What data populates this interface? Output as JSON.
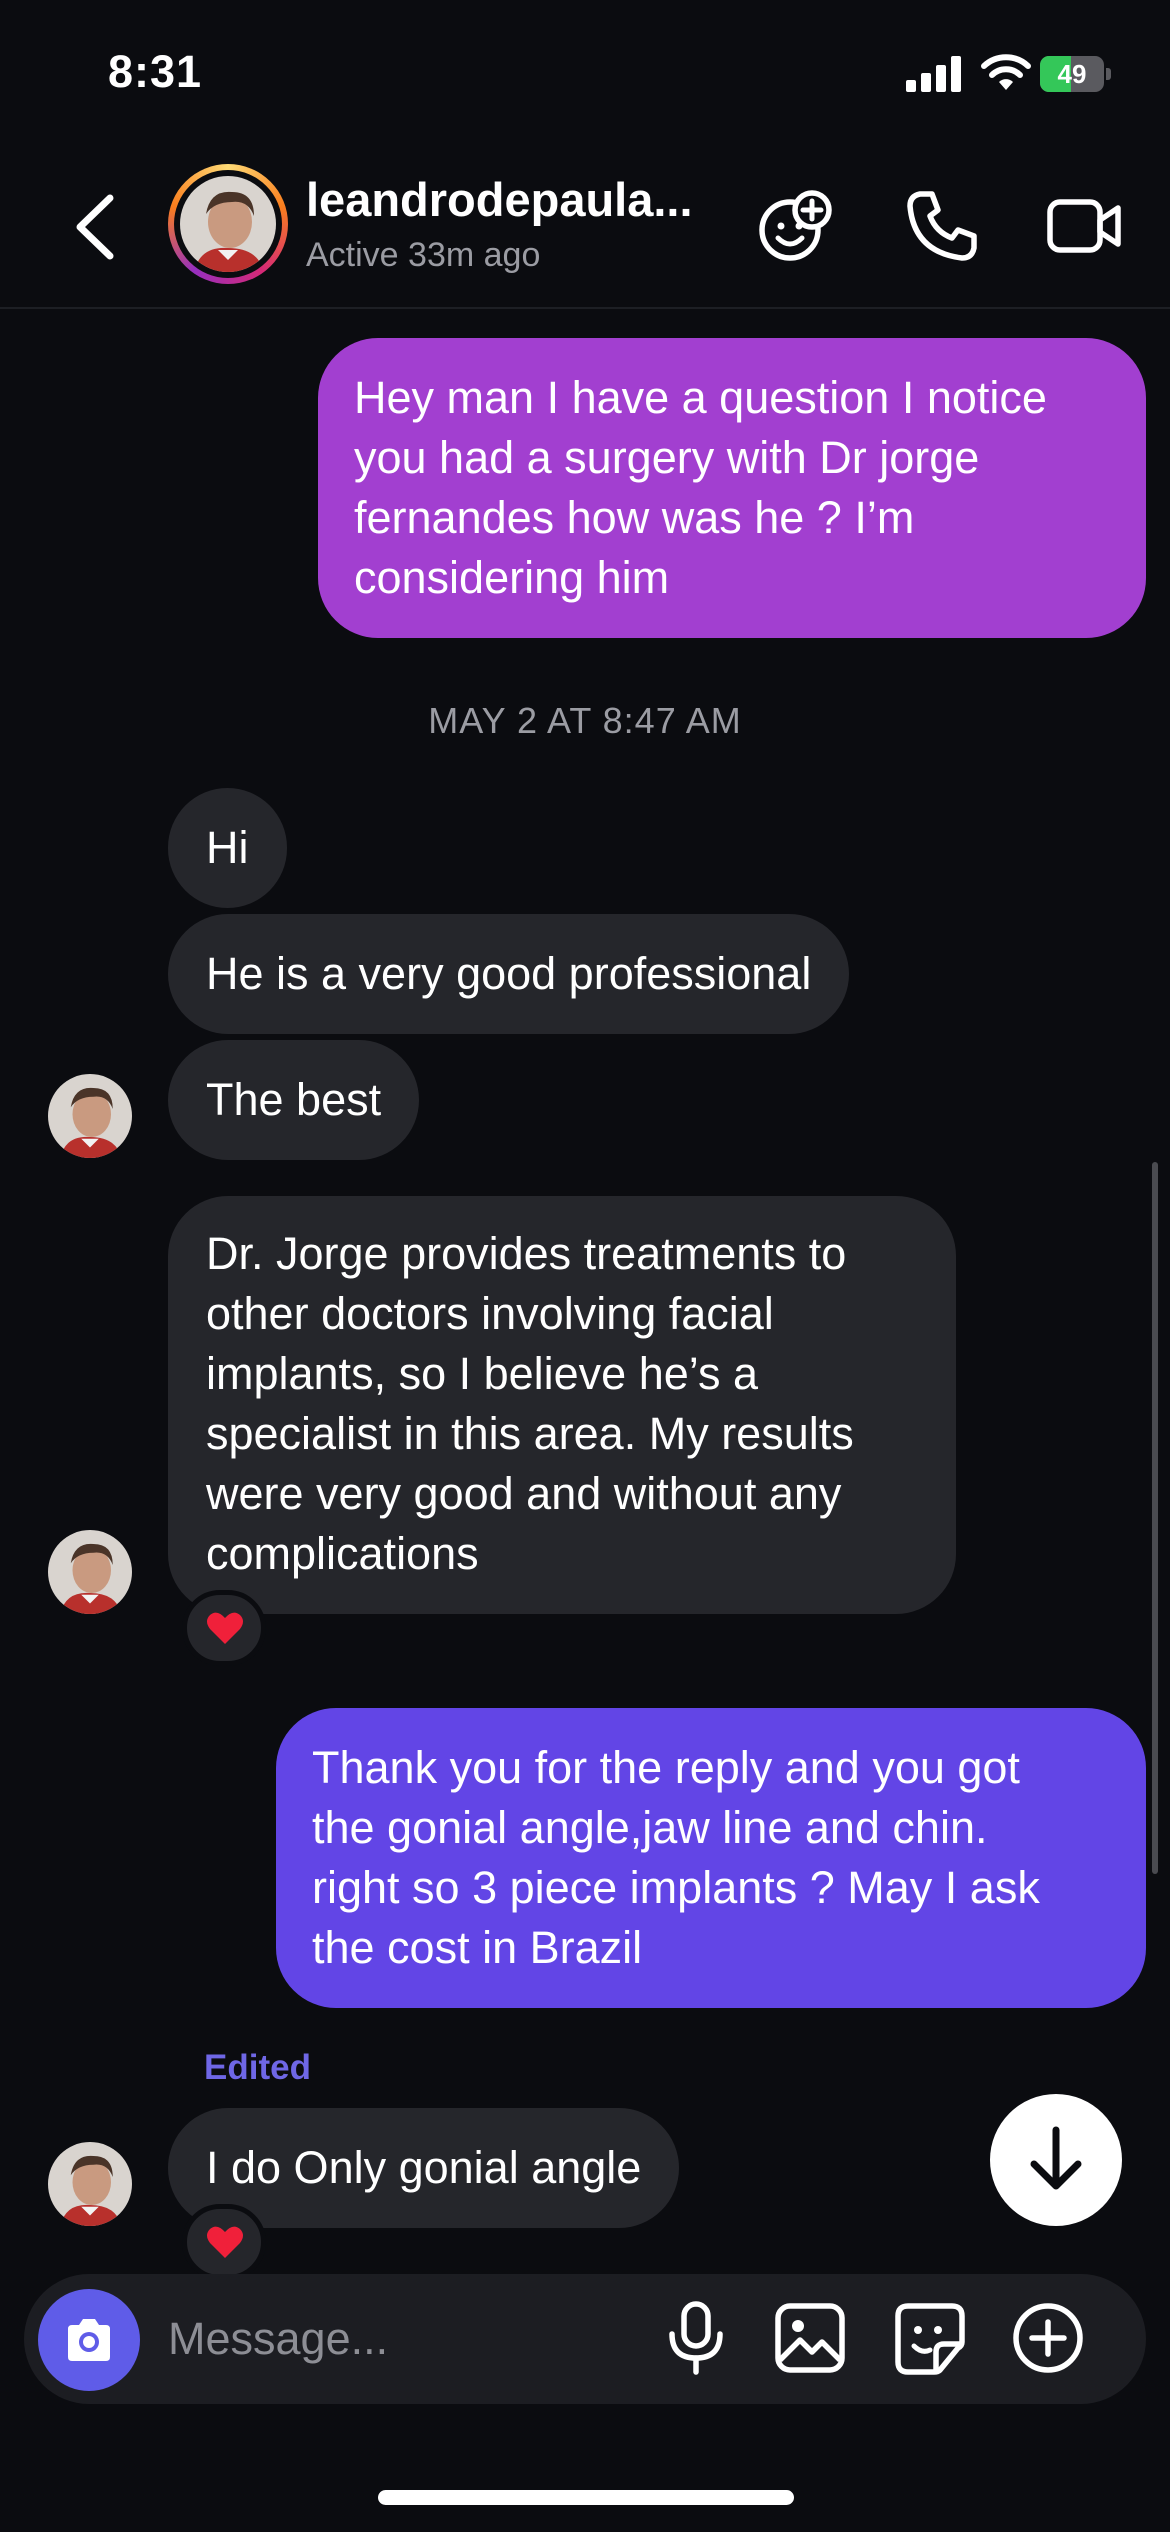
{
  "status_bar": {
    "time": "8:31",
    "battery": "49"
  },
  "header": {
    "username": "leandrodepaula...",
    "status": "Active 33m ago"
  },
  "messages": {
    "m1": [
      "Hey man I have a question I notice",
      "you had a surgery with Dr jorge",
      "fernandes how was he ? I’m",
      "considering him"
    ],
    "date_separator": "MAY 2 AT 8:47 AM",
    "m2": "Hi",
    "m3": "He is a very good professional",
    "m4": "The best",
    "m5": [
      "Dr. Jorge provides treatments to",
      "other doctors involving facial",
      "implants, so I believe he’s a",
      "specialist in this area. My results",
      "were very good and without any",
      "complications"
    ],
    "m6": [
      "Thank you for the reply and you got",
      "the gonial angle,jaw line and chin.",
      "right so 3 piece implants ? May I ask",
      "the cost in Brazil"
    ],
    "edited_label": "Edited",
    "m7": "I do Only gonial angle",
    "reaction": "heart"
  },
  "composer": {
    "placeholder": "Message..."
  },
  "colors": {
    "background": "#0b0c10",
    "incoming_bubble": "#25262b",
    "outgoing_bubble_purple": "#a23fd0",
    "outgoing_bubble_indigo": "#6245e6",
    "accent": "#5f5ce8"
  },
  "icons": [
    "back-icon",
    "sticker-add-icon",
    "phone-icon",
    "video-icon",
    "camera-icon",
    "microphone-icon",
    "gallery-icon",
    "sticker-icon",
    "plus-icon",
    "arrow-down-icon",
    "heart-icon"
  ]
}
